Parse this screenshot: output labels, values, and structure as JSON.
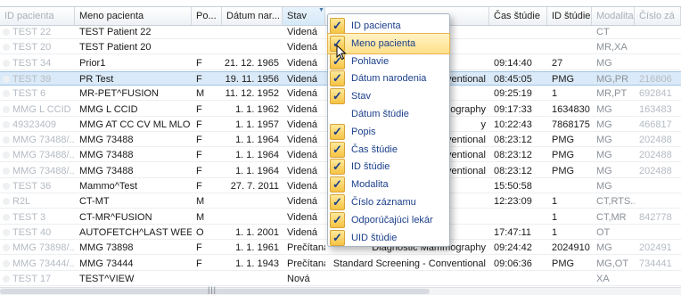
{
  "columns": [
    "ID pacienta",
    "Meno pacienta",
    "Po...",
    "Dátum nar...",
    "Stav",
    "",
    "Čas štúdie",
    "ID štúdie",
    "Modalita",
    "Číslo zá"
  ],
  "rows": [
    {
      "id": "TEST 22",
      "name": "TEST Patient 22",
      "sex": "",
      "dob": "",
      "stav": "Videná",
      "popis": "",
      "cas": "",
      "sid": "",
      "mod": "CT",
      "cz": ""
    },
    {
      "id": "TEST 20",
      "name": "TEST Patient 20",
      "sex": "",
      "dob": "",
      "stav": "Videná",
      "popis": "",
      "cas": "",
      "sid": "",
      "mod": "MR,XA",
      "cz": ""
    },
    {
      "id": "TEST 34",
      "name": "Prior1",
      "sex": "F",
      "dob": "21. 12. 1965",
      "stav": "Videná",
      "popis": "",
      "cas": "09:14:40",
      "sid": "27",
      "mod": "MG",
      "cz": ""
    },
    {
      "id": "TEST 39",
      "name": "PR Test",
      "sex": "F",
      "dob": "19. 11. 1956",
      "stav": "Videná",
      "popis": "onventional",
      "cas": "08:45:05",
      "sid": "PMG",
      "mod": "MG,PR",
      "cz": "216806"
    },
    {
      "id": "TEST 6",
      "name": "MR-PET^FUSION",
      "sex": "M",
      "dob": "11. 12. 1952",
      "stav": "Videná",
      "popis": "",
      "cas": "09:25:19",
      "sid": "1",
      "mod": "MR,PT",
      "cz": "692841"
    },
    {
      "id": "MMG L CCID",
      "name": "MMG L CCID",
      "sex": "F",
      "dob": "1. 1. 1962",
      "stav": "Videná",
      "popis": "mography",
      "cas": "09:17:33",
      "sid": "1634830",
      "mod": "MG",
      "cz": "163483"
    },
    {
      "id": "49323409",
      "name": "MMG AT CC CV ML MLO ...",
      "sex": "F",
      "dob": "1. 1. 1957",
      "stav": "Videná",
      "popis": "y",
      "cas": "10:22:43",
      "sid": "7868175",
      "mod": "MG",
      "cz": "466817"
    },
    {
      "id": "MMG 73488/...",
      "name": "MMG 73488",
      "sex": "F",
      "dob": "1. 1. 1964",
      "stav": "Videná",
      "popis": "onventional",
      "cas": "08:23:12",
      "sid": "PMG",
      "mod": "MG",
      "cz": "202488"
    },
    {
      "id": "MMG 73488/...",
      "name": "MMG 73488",
      "sex": "F",
      "dob": "1. 1. 1964",
      "stav": "Videná",
      "popis": "onventional",
      "cas": "08:23:12",
      "sid": "PMG",
      "mod": "MG",
      "cz": "202488"
    },
    {
      "id": "MMG 73488/...",
      "name": "MMG 73488",
      "sex": "F",
      "dob": "1. 1. 1964",
      "stav": "Videná",
      "popis": "onventional",
      "cas": "08:23:12",
      "sid": "PMG",
      "mod": "MG",
      "cz": "202488"
    },
    {
      "id": "TEST 36",
      "name": "Mammo^Test",
      "sex": "F",
      "dob": "27. 7. 2011",
      "stav": "Videná",
      "popis": "",
      "cas": "15:50:58",
      "sid": "",
      "mod": "MG",
      "cz": ""
    },
    {
      "id": "R2L",
      "name": "CT-MT",
      "sex": "M",
      "dob": "",
      "stav": "Videná",
      "popis": "",
      "cas": "12:23:09",
      "sid": "1",
      "mod": "CT,RTS...",
      "cz": ""
    },
    {
      "id": "TEST 3",
      "name": "CT-MR^FUSION",
      "sex": "M",
      "dob": "",
      "stav": "Videná",
      "popis": "",
      "cas": "",
      "sid": "1",
      "mod": "CT,MR",
      "cz": "842778"
    },
    {
      "id": "TEST 40",
      "name": "AUTOFETCH^LAST WEEK",
      "sex": "O",
      "dob": "1. 1. 2001",
      "stav": "Videná",
      "popis": "",
      "cas": "17:47:11",
      "sid": "1",
      "mod": "OT",
      "cz": ""
    },
    {
      "id": "MMG 73898/...",
      "name": "MMG 73898",
      "sex": "F",
      "dob": "1. 1. 1961",
      "stav": "Prečítaná",
      "popis": "Diagnostic Mammography",
      "cas": "09:24:42",
      "sid": "2024910",
      "mod": "MG",
      "cz": "202491"
    },
    {
      "id": "MMG 73444/...",
      "name": "MMG 73444",
      "sex": "F",
      "dob": "1. 1. 1943",
      "stav": "Prečítaná",
      "popis": "Standard Screening - Conventional",
      "cas": "09:06:36",
      "sid": "PMG",
      "mod": "MG,OT",
      "cz": "734441"
    },
    {
      "id": "TEST 17",
      "name": "TEST^VIEW",
      "sex": "",
      "dob": "",
      "stav": "Nová",
      "popis": "",
      "cas": "",
      "sid": "",
      "mod": "XA",
      "cz": ""
    }
  ],
  "menu": [
    {
      "label": "ID pacienta",
      "checked": true
    },
    {
      "label": "Meno pacienta",
      "checked": true
    },
    {
      "label": "Pohlavie",
      "checked": true
    },
    {
      "label": "Dátum narodenia",
      "checked": true
    },
    {
      "label": "Stav",
      "checked": true
    },
    {
      "label": "Dátum štúdie",
      "checked": false
    },
    {
      "label": "Popis",
      "checked": true
    },
    {
      "label": "Čas štúdie",
      "checked": true
    },
    {
      "label": "ID štúdie",
      "checked": true
    },
    {
      "label": "Modalita",
      "checked": true
    },
    {
      "label": "Číslo záznamu",
      "checked": true
    },
    {
      "label": "Odporúčajúci lekár",
      "checked": true
    },
    {
      "label": "UID štúdie",
      "checked": true
    }
  ],
  "scroll_grip": "|||",
  "check_glyph": "✓"
}
